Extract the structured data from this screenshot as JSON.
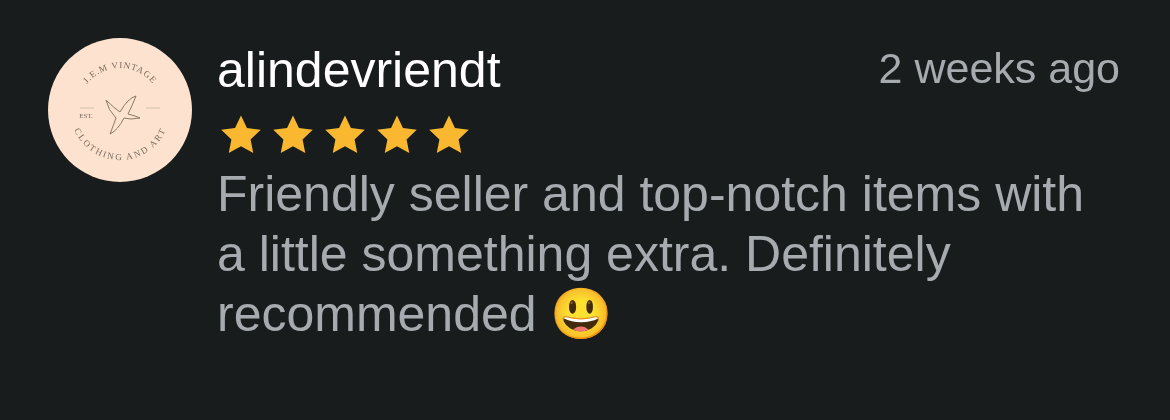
{
  "review": {
    "avatar": {
      "top_text": "J.E.M VINTAGE",
      "bottom_text": "CLOTHING AND ART",
      "left_text": "EST."
    },
    "author": "alindevriendt",
    "time": "2 weeks ago",
    "stars": 5,
    "text": "Friendly seller and top-notch items with a little something extra. Definitely recommended 😃"
  }
}
